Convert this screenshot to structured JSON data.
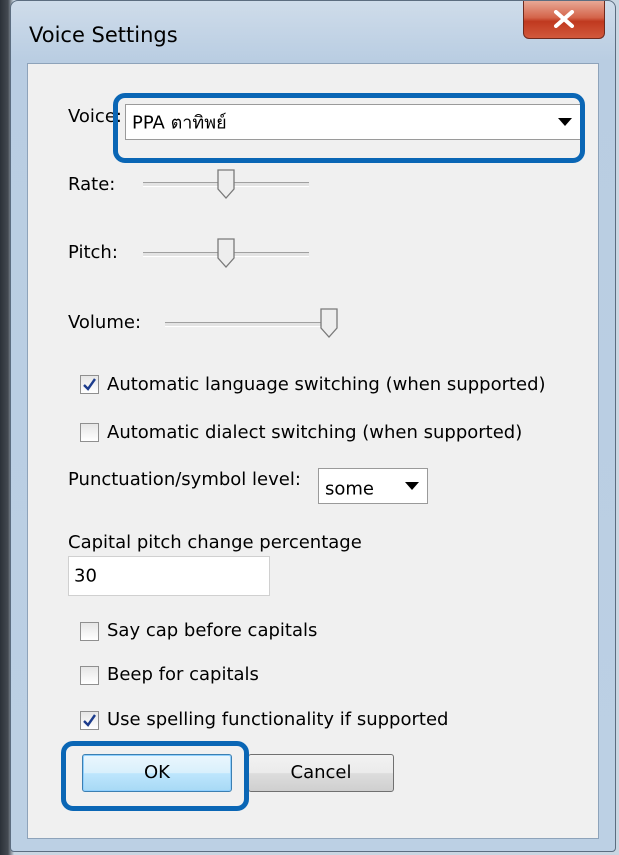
{
  "window": {
    "title": "Voice Settings"
  },
  "voice": {
    "label": "Voice:",
    "selected": "PPA ตาทิพย์"
  },
  "rate": {
    "label": "Rate:",
    "level": 0.5
  },
  "pitch": {
    "label": "Pitch:",
    "level": 0.5
  },
  "volume": {
    "label": "Volume:",
    "level": 1.0
  },
  "options": {
    "auto_language": {
      "label": "Automatic language switching (when supported)",
      "checked": true
    },
    "auto_dialect": {
      "label": "Automatic dialect switching (when supported)",
      "checked": false
    }
  },
  "punctuation": {
    "label": "Punctuation/symbol level:",
    "selected": "some"
  },
  "capital_pitch": {
    "label": "Capital pitch change percentage",
    "value": "30"
  },
  "caps": {
    "say_cap": {
      "label": "Say cap before capitals",
      "checked": false
    },
    "beep": {
      "label": "Beep for capitals",
      "checked": false
    },
    "spelling": {
      "label": "Use spelling functionality if supported",
      "checked": true
    }
  },
  "buttons": {
    "ok": "OK",
    "cancel": "Cancel"
  },
  "colors": {
    "highlight": "#0a66b5",
    "close_button": "#c0391f"
  }
}
